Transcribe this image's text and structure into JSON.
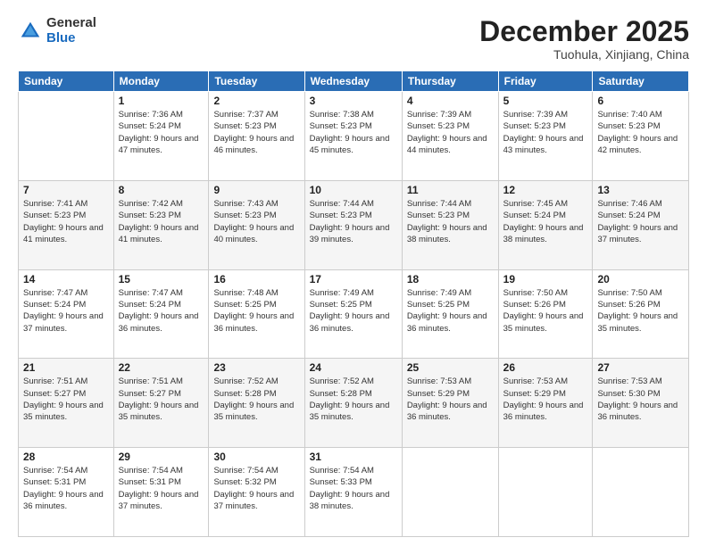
{
  "logo": {
    "general": "General",
    "blue": "Blue"
  },
  "header": {
    "month": "December 2025",
    "location": "Tuohula, Xinjiang, China"
  },
  "weekdays": [
    "Sunday",
    "Monday",
    "Tuesday",
    "Wednesday",
    "Thursday",
    "Friday",
    "Saturday"
  ],
  "weeks": [
    [
      {
        "day": "",
        "sunrise": "",
        "sunset": "",
        "daylight": ""
      },
      {
        "day": "1",
        "sunrise": "Sunrise: 7:36 AM",
        "sunset": "Sunset: 5:24 PM",
        "daylight": "Daylight: 9 hours and 47 minutes."
      },
      {
        "day": "2",
        "sunrise": "Sunrise: 7:37 AM",
        "sunset": "Sunset: 5:23 PM",
        "daylight": "Daylight: 9 hours and 46 minutes."
      },
      {
        "day": "3",
        "sunrise": "Sunrise: 7:38 AM",
        "sunset": "Sunset: 5:23 PM",
        "daylight": "Daylight: 9 hours and 45 minutes."
      },
      {
        "day": "4",
        "sunrise": "Sunrise: 7:39 AM",
        "sunset": "Sunset: 5:23 PM",
        "daylight": "Daylight: 9 hours and 44 minutes."
      },
      {
        "day": "5",
        "sunrise": "Sunrise: 7:39 AM",
        "sunset": "Sunset: 5:23 PM",
        "daylight": "Daylight: 9 hours and 43 minutes."
      },
      {
        "day": "6",
        "sunrise": "Sunrise: 7:40 AM",
        "sunset": "Sunset: 5:23 PM",
        "daylight": "Daylight: 9 hours and 42 minutes."
      }
    ],
    [
      {
        "day": "7",
        "sunrise": "Sunrise: 7:41 AM",
        "sunset": "Sunset: 5:23 PM",
        "daylight": "Daylight: 9 hours and 41 minutes."
      },
      {
        "day": "8",
        "sunrise": "Sunrise: 7:42 AM",
        "sunset": "Sunset: 5:23 PM",
        "daylight": "Daylight: 9 hours and 41 minutes."
      },
      {
        "day": "9",
        "sunrise": "Sunrise: 7:43 AM",
        "sunset": "Sunset: 5:23 PM",
        "daylight": "Daylight: 9 hours and 40 minutes."
      },
      {
        "day": "10",
        "sunrise": "Sunrise: 7:44 AM",
        "sunset": "Sunset: 5:23 PM",
        "daylight": "Daylight: 9 hours and 39 minutes."
      },
      {
        "day": "11",
        "sunrise": "Sunrise: 7:44 AM",
        "sunset": "Sunset: 5:23 PM",
        "daylight": "Daylight: 9 hours and 38 minutes."
      },
      {
        "day": "12",
        "sunrise": "Sunrise: 7:45 AM",
        "sunset": "Sunset: 5:24 PM",
        "daylight": "Daylight: 9 hours and 38 minutes."
      },
      {
        "day": "13",
        "sunrise": "Sunrise: 7:46 AM",
        "sunset": "Sunset: 5:24 PM",
        "daylight": "Daylight: 9 hours and 37 minutes."
      }
    ],
    [
      {
        "day": "14",
        "sunrise": "Sunrise: 7:47 AM",
        "sunset": "Sunset: 5:24 PM",
        "daylight": "Daylight: 9 hours and 37 minutes."
      },
      {
        "day": "15",
        "sunrise": "Sunrise: 7:47 AM",
        "sunset": "Sunset: 5:24 PM",
        "daylight": "Daylight: 9 hours and 36 minutes."
      },
      {
        "day": "16",
        "sunrise": "Sunrise: 7:48 AM",
        "sunset": "Sunset: 5:25 PM",
        "daylight": "Daylight: 9 hours and 36 minutes."
      },
      {
        "day": "17",
        "sunrise": "Sunrise: 7:49 AM",
        "sunset": "Sunset: 5:25 PM",
        "daylight": "Daylight: 9 hours and 36 minutes."
      },
      {
        "day": "18",
        "sunrise": "Sunrise: 7:49 AM",
        "sunset": "Sunset: 5:25 PM",
        "daylight": "Daylight: 9 hours and 36 minutes."
      },
      {
        "day": "19",
        "sunrise": "Sunrise: 7:50 AM",
        "sunset": "Sunset: 5:26 PM",
        "daylight": "Daylight: 9 hours and 35 minutes."
      },
      {
        "day": "20",
        "sunrise": "Sunrise: 7:50 AM",
        "sunset": "Sunset: 5:26 PM",
        "daylight": "Daylight: 9 hours and 35 minutes."
      }
    ],
    [
      {
        "day": "21",
        "sunrise": "Sunrise: 7:51 AM",
        "sunset": "Sunset: 5:27 PM",
        "daylight": "Daylight: 9 hours and 35 minutes."
      },
      {
        "day": "22",
        "sunrise": "Sunrise: 7:51 AM",
        "sunset": "Sunset: 5:27 PM",
        "daylight": "Daylight: 9 hours and 35 minutes."
      },
      {
        "day": "23",
        "sunrise": "Sunrise: 7:52 AM",
        "sunset": "Sunset: 5:28 PM",
        "daylight": "Daylight: 9 hours and 35 minutes."
      },
      {
        "day": "24",
        "sunrise": "Sunrise: 7:52 AM",
        "sunset": "Sunset: 5:28 PM",
        "daylight": "Daylight: 9 hours and 35 minutes."
      },
      {
        "day": "25",
        "sunrise": "Sunrise: 7:53 AM",
        "sunset": "Sunset: 5:29 PM",
        "daylight": "Daylight: 9 hours and 36 minutes."
      },
      {
        "day": "26",
        "sunrise": "Sunrise: 7:53 AM",
        "sunset": "Sunset: 5:29 PM",
        "daylight": "Daylight: 9 hours and 36 minutes."
      },
      {
        "day": "27",
        "sunrise": "Sunrise: 7:53 AM",
        "sunset": "Sunset: 5:30 PM",
        "daylight": "Daylight: 9 hours and 36 minutes."
      }
    ],
    [
      {
        "day": "28",
        "sunrise": "Sunrise: 7:54 AM",
        "sunset": "Sunset: 5:31 PM",
        "daylight": "Daylight: 9 hours and 36 minutes."
      },
      {
        "day": "29",
        "sunrise": "Sunrise: 7:54 AM",
        "sunset": "Sunset: 5:31 PM",
        "daylight": "Daylight: 9 hours and 37 minutes."
      },
      {
        "day": "30",
        "sunrise": "Sunrise: 7:54 AM",
        "sunset": "Sunset: 5:32 PM",
        "daylight": "Daylight: 9 hours and 37 minutes."
      },
      {
        "day": "31",
        "sunrise": "Sunrise: 7:54 AM",
        "sunset": "Sunset: 5:33 PM",
        "daylight": "Daylight: 9 hours and 38 minutes."
      },
      {
        "day": "",
        "sunrise": "",
        "sunset": "",
        "daylight": ""
      },
      {
        "day": "",
        "sunrise": "",
        "sunset": "",
        "daylight": ""
      },
      {
        "day": "",
        "sunrise": "",
        "sunset": "",
        "daylight": ""
      }
    ]
  ]
}
